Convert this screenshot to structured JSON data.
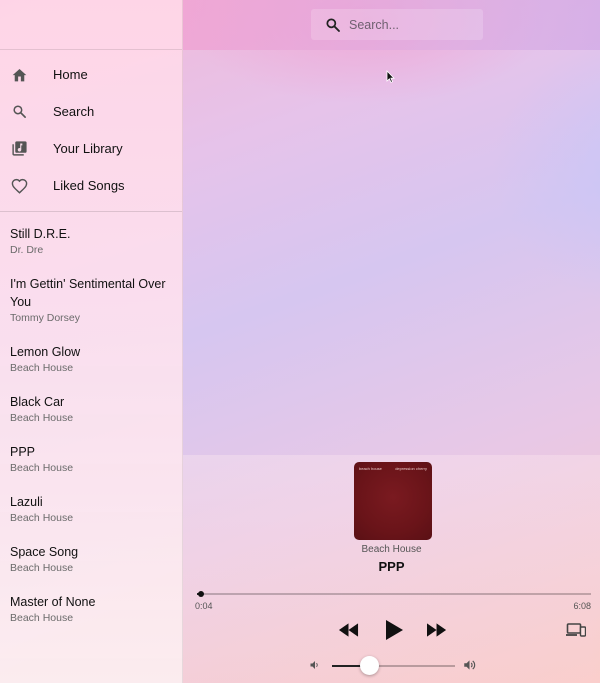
{
  "search": {
    "placeholder": "Search..."
  },
  "nav": {
    "items": [
      {
        "label": "Home",
        "icon": "home-icon"
      },
      {
        "label": "Search",
        "icon": "search-icon"
      },
      {
        "label": "Your Library",
        "icon": "library-icon"
      },
      {
        "label": "Liked Songs",
        "icon": "heart-icon"
      }
    ]
  },
  "tracks": [
    {
      "title": "Still D.R.E.",
      "artist": "Dr. Dre"
    },
    {
      "title": "I'm Gettin' Sentimental Over You",
      "artist": "Tommy Dorsey"
    },
    {
      "title": "Lemon Glow",
      "artist": "Beach House"
    },
    {
      "title": "Black Car",
      "artist": "Beach House"
    },
    {
      "title": "PPP",
      "artist": "Beach House"
    },
    {
      "title": "Lazuli",
      "artist": "Beach House"
    },
    {
      "title": "Space Song",
      "artist": "Beach House"
    },
    {
      "title": "Master of None",
      "artist": "Beach House"
    }
  ],
  "player": {
    "album_art": {
      "text_left": "beach house",
      "text_right": "depression cherry",
      "color": "#6a1419"
    },
    "artist": "Beach House",
    "title": "PPP",
    "elapsed": "0:04",
    "total": "6:08",
    "progress_fraction": 0.011,
    "volume_fraction": 0.3
  }
}
